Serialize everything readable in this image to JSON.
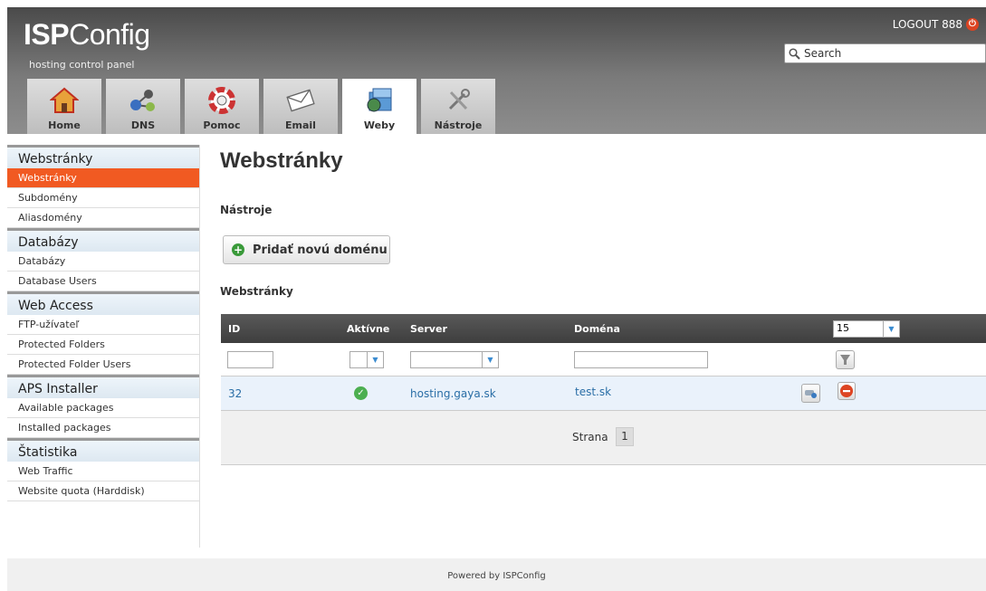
{
  "header": {
    "logo_bold": "ISP",
    "logo_rest": "Config",
    "tagline": "hosting control panel",
    "logout_label": "LOGOUT 888",
    "search_placeholder": "Search"
  },
  "tabs": [
    {
      "label": "Home",
      "icon": "home-icon"
    },
    {
      "label": "DNS",
      "icon": "dns-icon"
    },
    {
      "label": "Pomoc",
      "icon": "help-lifebuoy-icon"
    },
    {
      "label": "Email",
      "icon": "email-envelope-icon"
    },
    {
      "label": "Weby",
      "icon": "web-folder-icon",
      "active": true
    },
    {
      "label": "Nástroje",
      "icon": "tools-icon"
    }
  ],
  "sidebar": {
    "sections": [
      {
        "title": "Webstránky",
        "items": [
          "Webstránky",
          "Subdomény",
          "Aliasdomény"
        ]
      },
      {
        "title": "Databázy",
        "items": [
          "Databázy",
          "Database Users"
        ]
      },
      {
        "title": "Web Access",
        "items": [
          "FTP-užívateľ",
          "Protected Folders",
          "Protected Folder Users"
        ]
      },
      {
        "title": "APS Installer",
        "items": [
          "Available packages",
          "Installed packages"
        ]
      },
      {
        "title": "Štatistika",
        "items": [
          "Web Traffic",
          "Website quota (Harddisk)"
        ]
      }
    ],
    "active_item": "Webstránky"
  },
  "main": {
    "title": "Webstránky",
    "tools_label": "Nástroje",
    "add_button": "Pridať novú doménu",
    "list_label": "Webstránky"
  },
  "table": {
    "columns": {
      "id": "ID",
      "active": "Aktívne",
      "server": "Server",
      "domain": "Doména"
    },
    "per_page": "15",
    "rows": [
      {
        "id": "32",
        "active": true,
        "server": "hosting.gaya.sk",
        "domain": "test.sk"
      }
    ],
    "pager_label": "Strana",
    "page": "1"
  },
  "footer": {
    "text": "Powered by ISPConfig"
  },
  "colors": {
    "accent": "#f15a22",
    "link": "#2a6ea6",
    "header_dark": "#4a4a4a"
  }
}
